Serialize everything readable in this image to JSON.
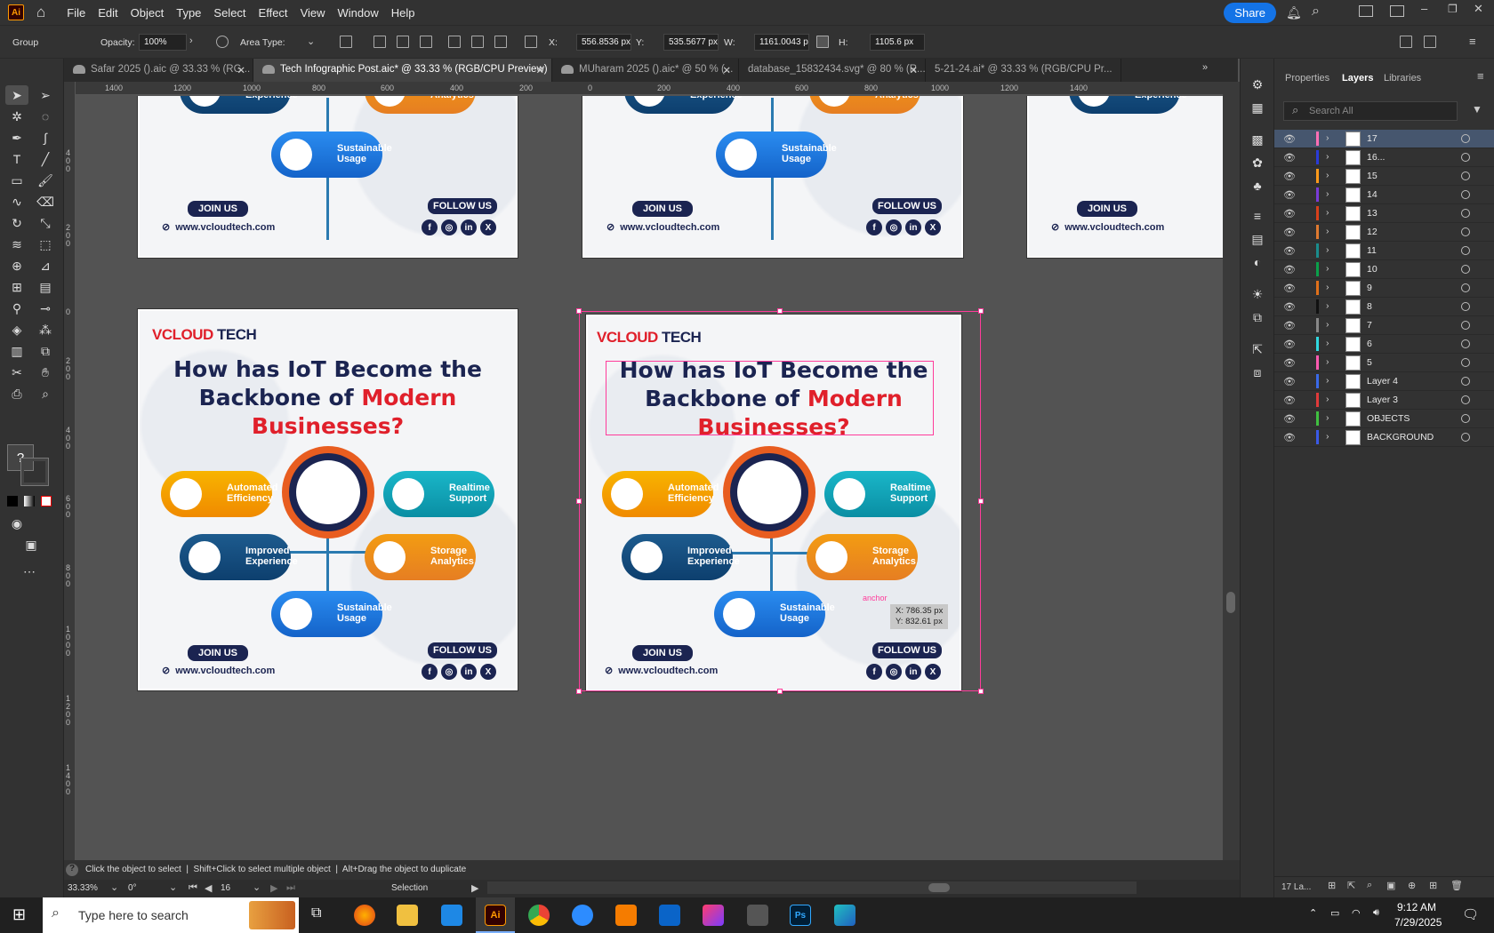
{
  "menubar": {
    "items": [
      "File",
      "Edit",
      "Object",
      "Type",
      "Select",
      "Effect",
      "View",
      "Window",
      "Help"
    ],
    "share_label": "Share"
  },
  "controlbar": {
    "selection_type": "Group",
    "opacity_label": "Opacity:",
    "opacity_value": "100%",
    "area_type_label": "Area Type:",
    "x_label": "X:",
    "x_value": "556.8536 px",
    "y_label": "Y:",
    "y_value": "535.5677 px",
    "w_label": "W:",
    "w_value": "1161.0043 p",
    "h_label": "H:",
    "h_value": "1105.6 px"
  },
  "tabs": [
    {
      "label": "Safar 2025 ().aic @ 33.33 % (RG...",
      "active": false
    },
    {
      "label": "Tech Infographic Post.aic* @ 33.33 % (RGB/CPU Preview)",
      "active": true
    },
    {
      "label": "MUharam 2025 ().aic* @ 50 % (...",
      "active": false
    },
    {
      "label": "database_15832434.svg* @ 80 % (R...",
      "active": false
    },
    {
      "label": "5-21-24.ai* @ 33.33 % (RGB/CPU Pr...",
      "active": false
    }
  ],
  "ruler": {
    "h_ticks": [
      "1400",
      "1200",
      "1000",
      "800",
      "600",
      "400",
      "200",
      "0",
      "200",
      "400",
      "600",
      "800",
      "1000",
      "1200",
      "1400"
    ],
    "v_ticks": [
      "4\n0\n0",
      "2\n0\n0",
      "0",
      "2\n0\n0",
      "4\n0\n0",
      "6\n0\n0",
      "8\n0\n0",
      "1\n0\n0\n0",
      "1\n2\n0\n0",
      "1\n4\n0\n0"
    ]
  },
  "artboard": {
    "brand_a": "VCLOUD",
    "brand_b": " TECH",
    "headline_1": "How has IoT Become the",
    "headline_2a": "Backbone of ",
    "headline_2b": "Modern",
    "headline_3": "Businesses?",
    "items": {
      "automated": "Automated Efficiency",
      "realtime": "Realtime Support",
      "improved": "Improved Experience",
      "storage": "Storage Analytics",
      "sustainable": "Sustainable Usage"
    },
    "join": "JOIN US",
    "follow": "FOLLOW US",
    "url": "www.vcloudtech.com",
    "social": [
      "f",
      "◎",
      "in",
      "X"
    ]
  },
  "canvas_overlay": {
    "anchor_label": "anchor",
    "tooltip_x": "X: 786.35 px",
    "tooltip_y": "Y: 832.61 px"
  },
  "panel": {
    "tabs": [
      "Properties",
      "Layers",
      "Libraries"
    ],
    "search_placeholder": "Search All",
    "layers": [
      {
        "name": "17",
        "color": "#ff6fb5",
        "selected": true
      },
      {
        "name": "16...",
        "color": "#2a3bd8"
      },
      {
        "name": "15",
        "color": "#ff9a1a"
      },
      {
        "name": "14",
        "color": "#7a3bd8"
      },
      {
        "name": "13",
        "color": "#d8401a"
      },
      {
        "name": "12",
        "color": "#e07a30"
      },
      {
        "name": "11",
        "color": "#1a8c8c"
      },
      {
        "name": "10",
        "color": "#0aa04a"
      },
      {
        "name": "9",
        "color": "#e0701a"
      },
      {
        "name": "8",
        "color": "#111111"
      },
      {
        "name": "7",
        "color": "#888888"
      },
      {
        "name": "6",
        "color": "#30d8e0"
      },
      {
        "name": "5",
        "color": "#ff5ab0"
      },
      {
        "name": "Layer 4",
        "color": "#3a6ae8"
      },
      {
        "name": "Layer 3",
        "color": "#e03a3a"
      },
      {
        "name": "OBJECTS",
        "color": "#40c040"
      },
      {
        "name": "BACKGROUND",
        "color": "#3a5ae8"
      }
    ],
    "footer_count": "17 La..."
  },
  "statusbar": {
    "hint": "Click the object to select  |  Shift+Click to select multiple object  |  Alt+Drag the object to duplicate",
    "zoom": "33.33%",
    "rotation": "0°",
    "artboard_num": "16",
    "tool": "Selection"
  },
  "taskbar": {
    "search_placeholder": "Type here to search",
    "time": "9:12 AM",
    "date": "7/29/2025"
  }
}
